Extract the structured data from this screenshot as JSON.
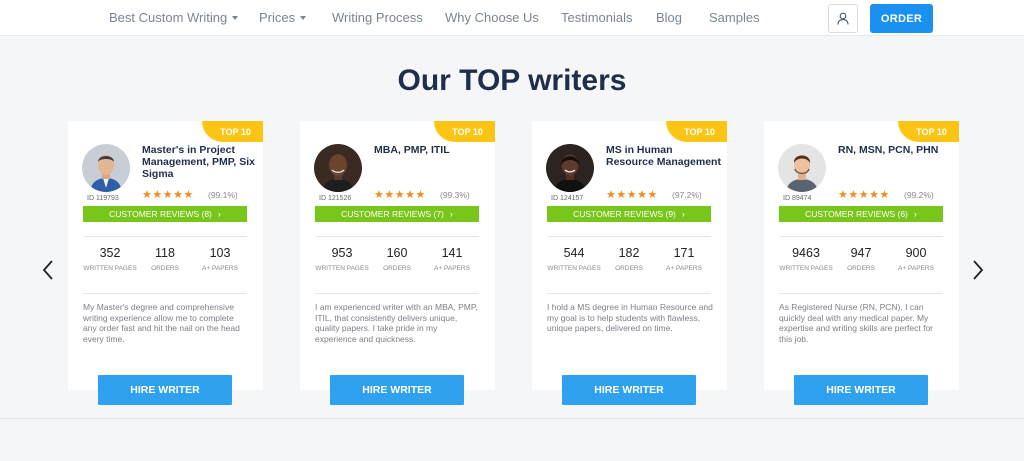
{
  "nav": {
    "items": [
      {
        "label": "Best Custom Writing",
        "has_caret": true
      },
      {
        "label": "Prices",
        "has_caret": true
      },
      {
        "label": "Writing Process",
        "has_caret": false
      },
      {
        "label": "Why Choose Us",
        "has_caret": false
      },
      {
        "label": "Testimonials",
        "has_caret": false
      },
      {
        "label": "Blog",
        "has_caret": false
      },
      {
        "label": "Samples",
        "has_caret": false
      }
    ],
    "user_icon": "user-icon",
    "order_label": "ORDER"
  },
  "section": {
    "title": "Our TOP writers"
  },
  "carousel": {
    "prev_icon": "chevron-left-icon",
    "next_icon": "chevron-right-icon"
  },
  "writers": [
    {
      "badge": "TOP 10",
      "id": "ID 119793",
      "degree": "Master's in Project Management, PMP, Six Sigma",
      "stars": "★★★★★",
      "rating": "(99.1%)",
      "reviews_label": "CUSTOMER REVIEWS (8)",
      "stats": [
        {
          "value": "352",
          "label": "WRITTEN PAGES"
        },
        {
          "value": "118",
          "label": "ORDERS"
        },
        {
          "value": "103",
          "label": "A+ PAPERS"
        }
      ],
      "bio": "My Master's degree and comprehensive writing experience allow me to complete any order fast and hit the nail on the head every time.",
      "hire_label": "HIRE WRITER"
    },
    {
      "badge": "TOP 10",
      "id": "ID 121526",
      "degree": "MBA, PMP, ITIL",
      "stars": "★★★★★",
      "rating": "(99.3%)",
      "reviews_label": "CUSTOMER REVIEWS (7)",
      "stats": [
        {
          "value": "953",
          "label": "WRITTEN PAGES"
        },
        {
          "value": "160",
          "label": "ORDERS"
        },
        {
          "value": "141",
          "label": "A+ PAPERS"
        }
      ],
      "bio": "I am experienced writer with an MBA, PMP, ITIL, that consistently delivers unique, quality papers. I take pride in my experience and quickness.",
      "hire_label": "HIRE WRITER"
    },
    {
      "badge": "TOP 10",
      "id": "ID 124157",
      "degree": "MS in Human Resource Management",
      "stars": "★★★★★",
      "rating": "(97.2%)",
      "reviews_label": "CUSTOMER REVIEWS (9)",
      "stats": [
        {
          "value": "544",
          "label": "WRITTEN PAGES"
        },
        {
          "value": "182",
          "label": "ORDERS"
        },
        {
          "value": "171",
          "label": "A+ PAPERS"
        }
      ],
      "bio": "I hold a MS degree in Human Resource and my goal is to help students with flawless, unique papers, delivered on time.",
      "hire_label": "HIRE WRITER"
    },
    {
      "badge": "TOP 10",
      "id": "ID 89474",
      "degree": "RN, MSN, PCN, PHN",
      "stars": "★★★★★",
      "rating": "(99.2%)",
      "reviews_label": "CUSTOMER REVIEWS (6)",
      "stats": [
        {
          "value": "9463",
          "label": "WRITTEN PAGES"
        },
        {
          "value": "947",
          "label": "ORDERS"
        },
        {
          "value": "900",
          "label": "A+ PAPERS"
        }
      ],
      "bio": "As Registered Nurse (RN, PCN), I can quickly deal with any medical paper. My expertise and writing skills are perfect for this job.",
      "hire_label": "HIRE WRITER"
    }
  ],
  "colors": {
    "accent_blue": "#1a91f0",
    "review_green": "#78c51c",
    "badge_yellow": "#fcc514",
    "star_orange": "#f58a1f",
    "title_navy": "#1f2f4b"
  }
}
